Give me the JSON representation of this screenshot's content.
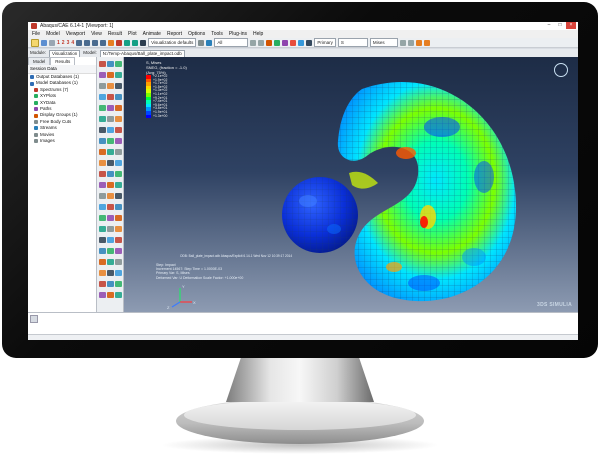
{
  "window": {
    "title": "Abaqus/CAE 6.14-1 [Viewport: 1]",
    "controls": [
      "–",
      "□",
      "×"
    ]
  },
  "menu": [
    "File",
    "Model",
    "Viewport",
    "View",
    "Result",
    "Plot",
    "Animate",
    "Report",
    "Options",
    "Tools",
    "Plug-ins",
    "Help"
  ],
  "toolbar": {
    "step_numbers": [
      "1",
      "2",
      "3",
      "4"
    ],
    "visualization_defaults": "Visualization defaults",
    "render_style": "All",
    "primary_label": "Primary",
    "primary_value": "S",
    "invariant_value": "Mises"
  },
  "context": {
    "module_label": "Module:",
    "module_value": "Visualization",
    "model_label": "Model:",
    "model_value": "N:/Temp-Abaqus/Ball_plate_impact.odb"
  },
  "left_panel": {
    "tabs": [
      "Model",
      "Results"
    ],
    "active_tab": "Results",
    "session": "Session Data",
    "items": [
      {
        "label": "Output Databases (1)",
        "icon": "database-icon",
        "color": "#2f6db5"
      },
      {
        "label": "Model Databases (1)",
        "icon": "database-icon",
        "color": "#2f6db5"
      },
      {
        "label": "Spectrums (7)",
        "icon": "spectrum-icon",
        "color": "#c0392b"
      },
      {
        "label": "XYPlots",
        "icon": "xyplot-icon",
        "color": "#27ae60"
      },
      {
        "label": "XYData",
        "icon": "xydata-icon",
        "color": "#27ae60"
      },
      {
        "label": "Paths",
        "icon": "path-icon",
        "color": "#8e44ad"
      },
      {
        "label": "Display Groups (1)",
        "icon": "display-group-icon",
        "color": "#d35400"
      },
      {
        "label": "Free Body Cuts",
        "icon": "free-body-icon",
        "color": "#7f8c8d"
      },
      {
        "label": "Streams",
        "icon": "stream-icon",
        "color": "#2980b9"
      },
      {
        "label": "Movies",
        "icon": "movie-icon",
        "color": "#7f8c8d"
      },
      {
        "label": "Images",
        "icon": "image-icon",
        "color": "#7f8c8d"
      }
    ]
  },
  "viewport": {
    "legend": {
      "title": "S, Mises",
      "subtitle": "(Avg: 75%)",
      "extra": "SNEG, (fraction = -1.0)",
      "colors": [
        "#ff0000",
        "#ff5a00",
        "#ffa000",
        "#ffd800",
        "#d8ff00",
        "#7cff00",
        "#00ff3c",
        "#00ffb4",
        "#00e6ff",
        "#0096ff",
        "#0046ff",
        "#0000ff"
      ],
      "values": [
        "+2.1e+02",
        "+1.9e+02",
        "+1.7e+02",
        "+1.5e+02",
        "+1.3e+02",
        "+1.1e+02",
        "+9.2e+01",
        "+7.4e+01",
        "+5.6e+01",
        "+3.8e+01",
        "+1.9e+01",
        "+1.3e+00"
      ]
    },
    "odb_line": "ODB: Ball_plate_impact.odb    Abaqus/Explicit 6.14-1    Wed Nov 12 10:39:17 2014",
    "status_lines": [
      "Step: Impact",
      "Increment   14567: Step Time = 1.0000E-03",
      "Primary Var: S, Mises",
      "Deformed Var: U   Deformation Scale Factor: +1.000e+00"
    ],
    "triad": {
      "x": "X",
      "y": "Y",
      "z": "Z"
    },
    "brand": "3DS SIMULIA"
  }
}
